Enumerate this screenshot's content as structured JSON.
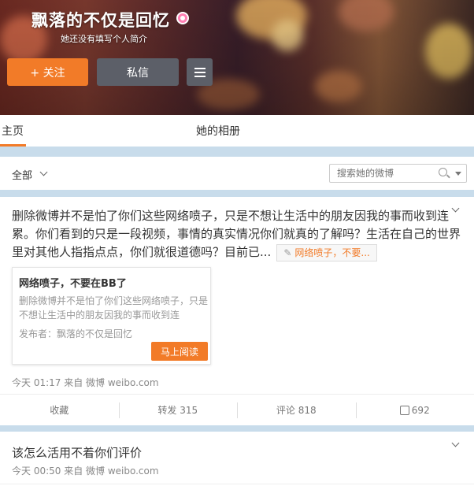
{
  "profile": {
    "username": "飘落的不仅是回忆",
    "bio": "她还没有填写个人简介",
    "follow_label": "+ 关注",
    "message_label": "私信"
  },
  "tabs": {
    "home": "主页",
    "album": "她的相册"
  },
  "filter": {
    "all_label": "全部",
    "search_placeholder": "搜索她的微博"
  },
  "post1": {
    "text_lines": [
      "删除微博并不是怕了你们这些网络喷子，只是不想让生活中的朋友因我的事而收到连",
      "累。你们看到的只是一段视频，事情的真实情况你们就真的了解吗？生活在自己的世界",
      "里对其他人指指点点，你们就很道德吗？目前已..."
    ],
    "link_card_label": "网络喷子，不要...",
    "article": {
      "title": "网络喷子，不要在BB了",
      "summary": "删除微博并不是怕了你们这些网络喷子，只是不想让生活中的朋友因我的事而收到连",
      "publisher": "发布者：飘落的不仅是回忆",
      "read_label": "马上阅读"
    },
    "meta": "今天 01:17 来自 微博 weibo.com",
    "actions": {
      "favorite": "收藏",
      "repost": "转发 315",
      "comment": "评论 818",
      "like": "692"
    }
  },
  "post2": {
    "text": "该怎么活用不着你们评价",
    "meta": "今天 00:50 来自 微博 weibo.com"
  },
  "colors": {
    "accent": "#f27b28",
    "dark_button": "#5c5f68",
    "band": "#c8dceb"
  }
}
